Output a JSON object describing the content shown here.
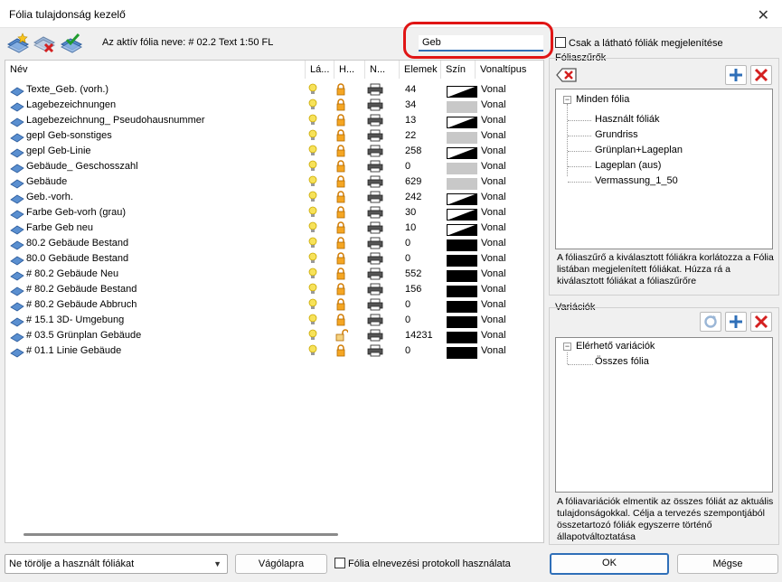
{
  "window": {
    "title": "Fólia tulajdonság kezelő",
    "close_glyph": "✕"
  },
  "toolbar": {
    "buttons": [
      {
        "name": "new-layer-icon"
      },
      {
        "name": "delete-layer-icon"
      },
      {
        "name": "apply-layer-icon"
      }
    ],
    "active_layer_label": "Az aktív fólia neve:  # 02.2 Text 1:50 FL",
    "search_value": "Geb",
    "visible_only_label": "Csak a látható fóliák megjelenítése"
  },
  "table": {
    "headers": [
      "Név",
      "Lá...",
      "H...",
      "N...",
      "Elemek",
      "Szín",
      "Vonaltípus"
    ],
    "rows": [
      {
        "name": "Texte_Geb. (vorh.)",
        "count": "44",
        "color": "bw",
        "lock": "closed",
        "line": "Vonal"
      },
      {
        "name": "Lagebezeichnungen",
        "count": "34",
        "color": "gray",
        "lock": "closed",
        "line": "Vonal"
      },
      {
        "name": "Lagebezeichnung_ Pseudohausnummer",
        "count": "13",
        "color": "bw",
        "lock": "closed",
        "line": "Vonal"
      },
      {
        "name": "gepl Geb-sonstiges",
        "count": "22",
        "color": "gray",
        "lock": "closed",
        "line": "Vonal"
      },
      {
        "name": "gepl Geb-Linie",
        "count": "258",
        "color": "bw",
        "lock": "closed",
        "line": "Vonal"
      },
      {
        "name": "Gebäude_ Geschosszahl",
        "count": "0",
        "color": "gray",
        "lock": "closed",
        "line": "Vonal"
      },
      {
        "name": "Gebäude",
        "count": "629",
        "color": "gray",
        "lock": "closed",
        "line": "Vonal"
      },
      {
        "name": "Geb.-vorh.",
        "count": "242",
        "color": "bw",
        "lock": "closed",
        "line": "Vonal"
      },
      {
        "name": "Farbe Geb-vorh (grau)",
        "count": "30",
        "color": "bw",
        "lock": "closed",
        "line": "Vonal"
      },
      {
        "name": "Farbe Geb neu",
        "count": "10",
        "color": "bw",
        "lock": "closed",
        "line": "Vonal"
      },
      {
        "name": "80.2 Gebäude Bestand",
        "count": "0",
        "color": "black",
        "lock": "closed",
        "line": "Vonal"
      },
      {
        "name": "80.0 Gebäude Bestand",
        "count": "0",
        "color": "black",
        "lock": "closed",
        "line": "Vonal"
      },
      {
        "name": "# 80.2 Gebäude Neu",
        "count": "552",
        "color": "black",
        "lock": "closed",
        "line": "Vonal"
      },
      {
        "name": "# 80.2 Gebäude Bestand",
        "count": "156",
        "color": "black",
        "lock": "closed",
        "line": "Vonal"
      },
      {
        "name": "# 80.2 Gebäude Abbruch",
        "count": "0",
        "color": "black",
        "lock": "closed",
        "line": "Vonal"
      },
      {
        "name": "# 15.1 3D- Umgebung",
        "count": "0",
        "color": "black",
        "lock": "closed",
        "line": "Vonal"
      },
      {
        "name": "# 03.5 Grünplan Gebäude",
        "count": "14231",
        "color": "black",
        "lock": "open",
        "line": "Vonal"
      },
      {
        "name": "# 01.1 Linie Gebäude",
        "count": "0",
        "color": "black",
        "lock": "closed",
        "line": "Vonal"
      }
    ]
  },
  "filters": {
    "label": "Fóliaszűrők",
    "root": "Minden fólia",
    "items": [
      "Használt fóliák",
      "Grundriss",
      "Grünplan+Lageplan",
      "Lageplan (aus)",
      "Vermassung_1_50"
    ],
    "description": "A fóliaszűrő a kiválasztott fóliákra korlátozza a Fólia listában megjelenített fóliákat. Húzza rá a kiválasztott fóliákat a fóliaszűrőre"
  },
  "variations": {
    "label": "Variációk",
    "root": "Elérhető variációk",
    "items": [
      "Összes fólia"
    ],
    "description": "A fóliavariációk elmentik az összes fóliát az aktuális tulajdonságokkal. Célja a tervezés szempontjából összetartozó fóliák egyszerre történő állapotváltoztatása"
  },
  "bottom": {
    "delete_mode": "Ne törölje a használt fóliákat",
    "clipboard_label": "Vágólapra",
    "protocol_label": "Fólia elnevezési protokoll használata",
    "ok_label": "OK",
    "cancel_label": "Mégse"
  },
  "colors": {
    "accent": "#2f6fb8",
    "highlight": "#e01515",
    "add": "#2f6fb8",
    "remove": "#d42020"
  }
}
